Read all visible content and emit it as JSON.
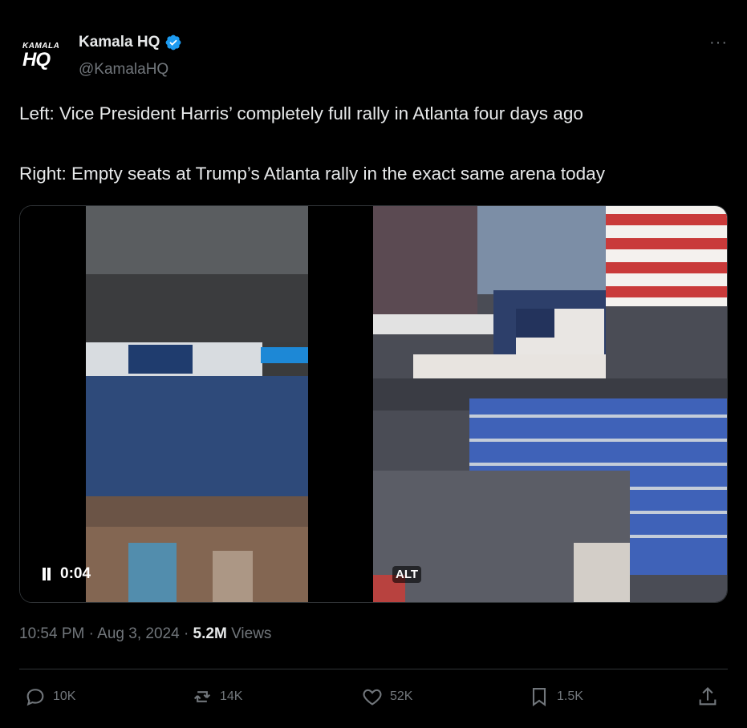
{
  "author": {
    "display_name": "Kamala HQ",
    "handle": "@KamalaHQ",
    "avatar_text_top": "KAMALA",
    "avatar_text_bottom": "HQ",
    "verified_color": "#1d9bf0"
  },
  "more_label": "···",
  "tweet": {
    "line1": "Left: Vice President Harris’ completely full rally in Atlanta four days ago",
    "line2": "Right: Empty seats at Trump’s Atlanta rally in the exact same arena today"
  },
  "media": {
    "video_time": "0:04",
    "alt_label": "ALT",
    "left_icon": "pause-icon"
  },
  "meta": {
    "time": "10:54 PM",
    "date": "Aug 3, 2024",
    "views_count": "5.2M",
    "views_label": "Views"
  },
  "actions": {
    "replies": "10K",
    "reposts": "14K",
    "likes": "52K",
    "bookmarks": "1.5K"
  },
  "colors": {
    "background": "#000000",
    "text": "#e7e9ea",
    "muted": "#71767b",
    "divider": "#2f3336"
  }
}
